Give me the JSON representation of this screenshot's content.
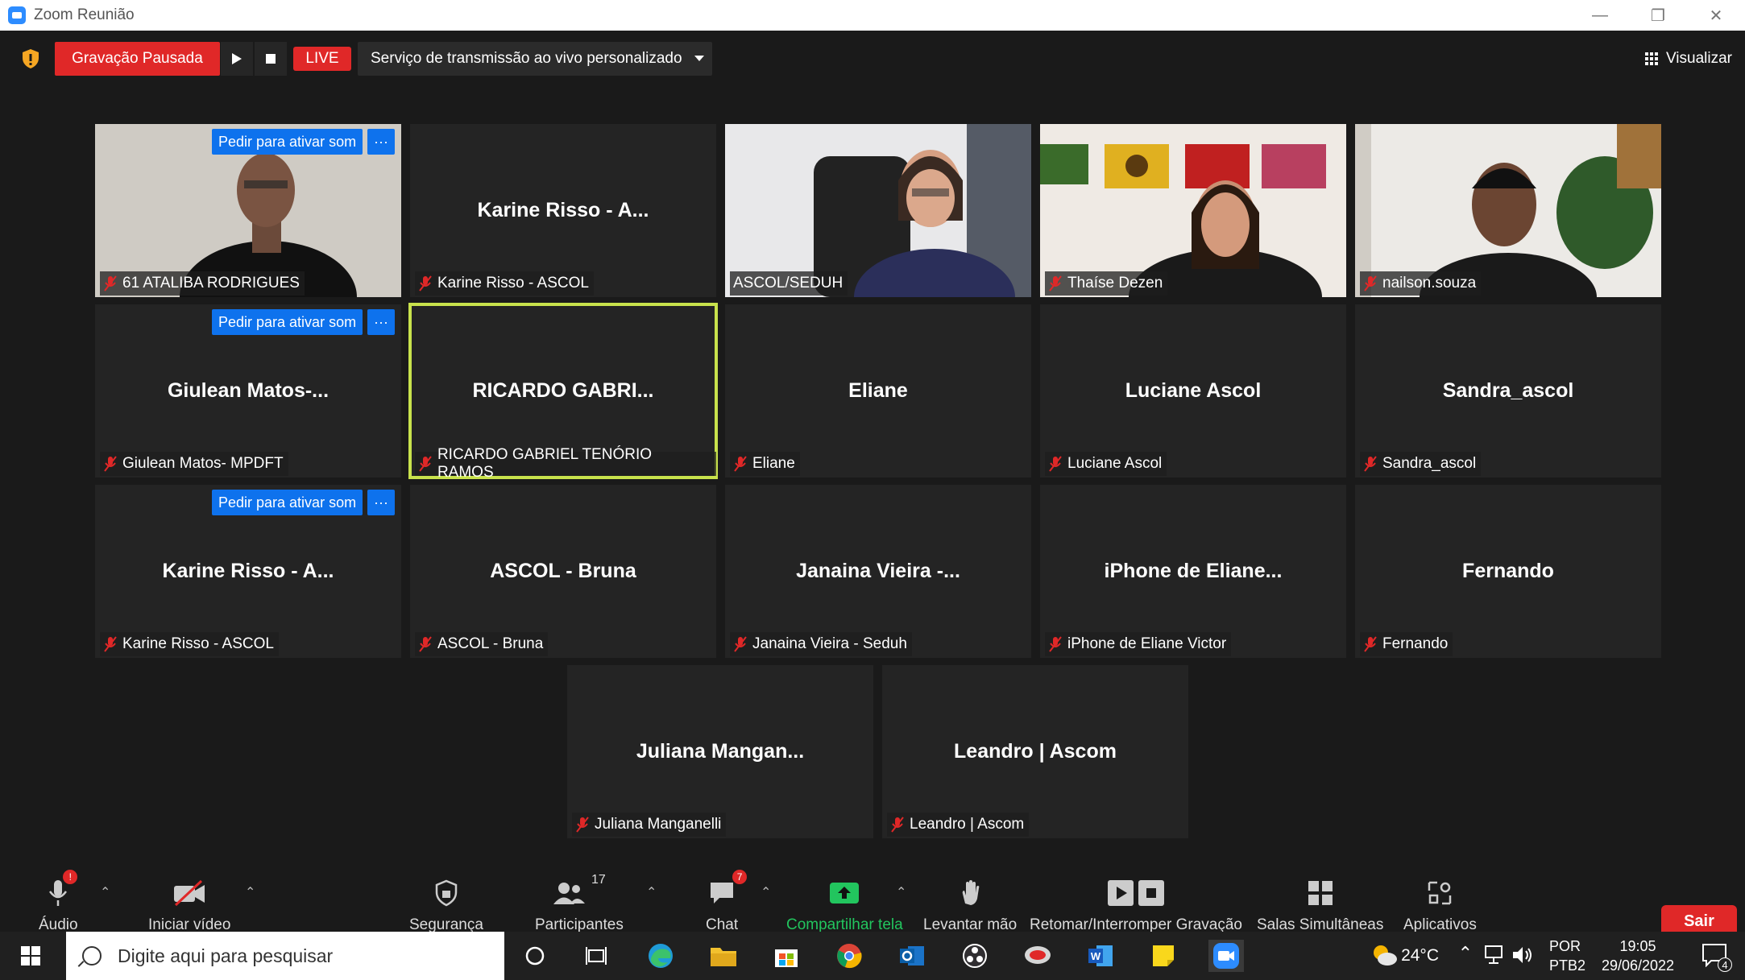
{
  "window": {
    "title": "Zoom Reunião",
    "controls": [
      "—",
      "❐",
      "✕"
    ]
  },
  "topbar": {
    "recording_status": "Gravação Pausada",
    "live_label": "LIVE",
    "stream_service": "Serviço de transmissão ao vivo personalizado",
    "view_label": "Visualizar"
  },
  "tiles": [
    {
      "big": "",
      "label": "61 ATALIBA RODRIGUES",
      "ask": "Pedir para ativar som",
      "more": "···"
    },
    {
      "big": "Karine Risso - A...",
      "label": "Karine Risso - ASCOL"
    },
    {
      "big": "",
      "label": "ASCOL/SEDUH"
    },
    {
      "big": "",
      "label": "Thaíse Dezen"
    },
    {
      "big": "",
      "label": "nailson.souza"
    },
    {
      "big": "Giulean Matos-...",
      "label": "Giulean Matos- MPDFT",
      "ask": "Pedir para ativar som",
      "more": "···"
    },
    {
      "big": "RICARDO GABRI...",
      "label": "RICARDO GABRIEL TENÓRIO RAMOS"
    },
    {
      "big": "Eliane",
      "label": "Eliane"
    },
    {
      "big": "Luciane Ascol",
      "label": "Luciane Ascol"
    },
    {
      "big": "Sandra_ascol",
      "label": "Sandra_ascol"
    },
    {
      "big": "Karine Risso - A...",
      "label": "Karine Risso - ASCOL",
      "ask": "Pedir para ativar som",
      "more": "···"
    },
    {
      "big": "ASCOL - Bruna",
      "label": "ASCOL - Bruna"
    },
    {
      "big": "Janaina Vieira -...",
      "label": "Janaina Vieira - Seduh"
    },
    {
      "big": "iPhone de Eliane...",
      "label": "iPhone de Eliane Victor"
    },
    {
      "big": "Fernando",
      "label": "Fernando"
    },
    {
      "big": "Juliana Mangan...",
      "label": "Juliana Manganelli"
    },
    {
      "big": "Leandro | Ascom",
      "label": "Leandro | Ascom"
    }
  ],
  "toolbar": {
    "audio": "Áudio",
    "audio_badge": "!",
    "video": "Iniciar vídeo",
    "security": "Segurança",
    "participants": "Participantes",
    "participants_count": "17",
    "chat": "Chat",
    "chat_badge": "7",
    "share": "Compartilhar tela",
    "raise_hand": "Levantar mão",
    "recording": "Retomar/Interromper Gravação",
    "breakout": "Salas Simultâneas",
    "apps": "Aplicativos",
    "leave": "Sair"
  },
  "taskbar": {
    "search_placeholder": "Digite aqui para pesquisar",
    "temperature": "24°C",
    "lang1": "POR",
    "lang2": "PTB2",
    "time": "19:05",
    "date": "29/06/2022",
    "notif_count": "4"
  },
  "colors": {
    "accent_blue": "#0e72ed",
    "record_red": "#e02828",
    "active_speaker": "#c8e24c",
    "share_green": "#22c55e"
  }
}
